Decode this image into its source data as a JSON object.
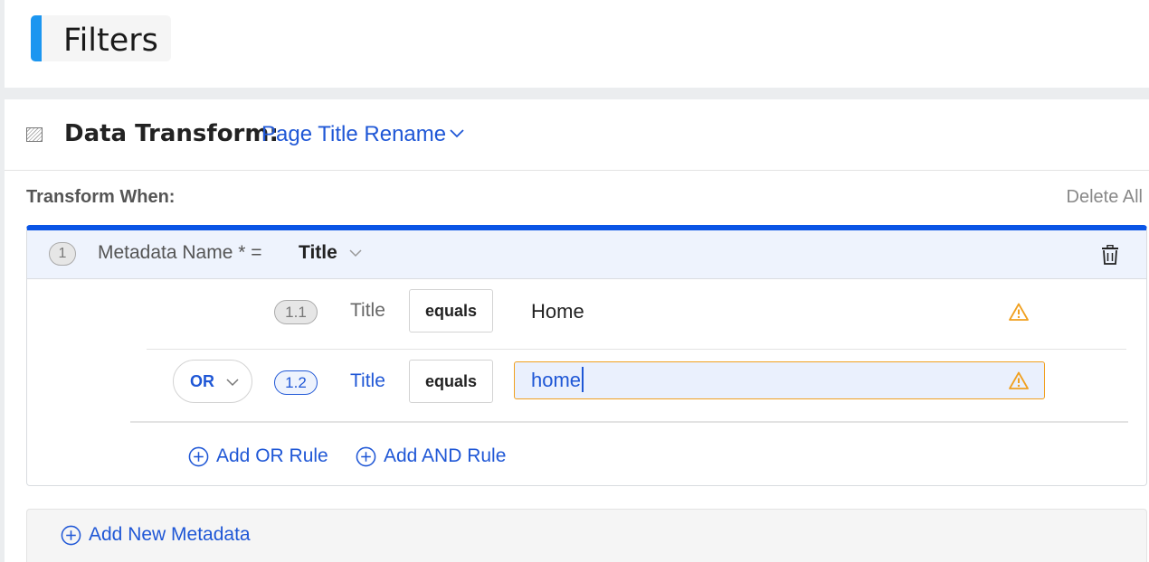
{
  "header": {
    "title": "Filters"
  },
  "transform": {
    "label": "Data Transform:",
    "selected": "Page Title Rename",
    "icon": "transform-icon"
  },
  "transform_when": {
    "label": "Transform When:",
    "delete_all": "Delete All"
  },
  "rule": {
    "number": "1",
    "metadata_label": "Metadata Name * =",
    "metadata_value": "Title",
    "sub_rules": [
      {
        "number": "1.1",
        "field": "Title",
        "operator": "equals",
        "value": "Home"
      },
      {
        "connector": "OR",
        "number": "1.2",
        "field": "Title",
        "operator": "equals",
        "value": "home"
      }
    ],
    "add_or": "Add OR Rule",
    "add_and": "Add AND Rule"
  },
  "add_metadata": "Add New Metadata",
  "colors": {
    "accent": "#1c96f0",
    "link": "#1f57d6",
    "rule_top_border": "#0a55e6",
    "warning": "#f0a020"
  }
}
